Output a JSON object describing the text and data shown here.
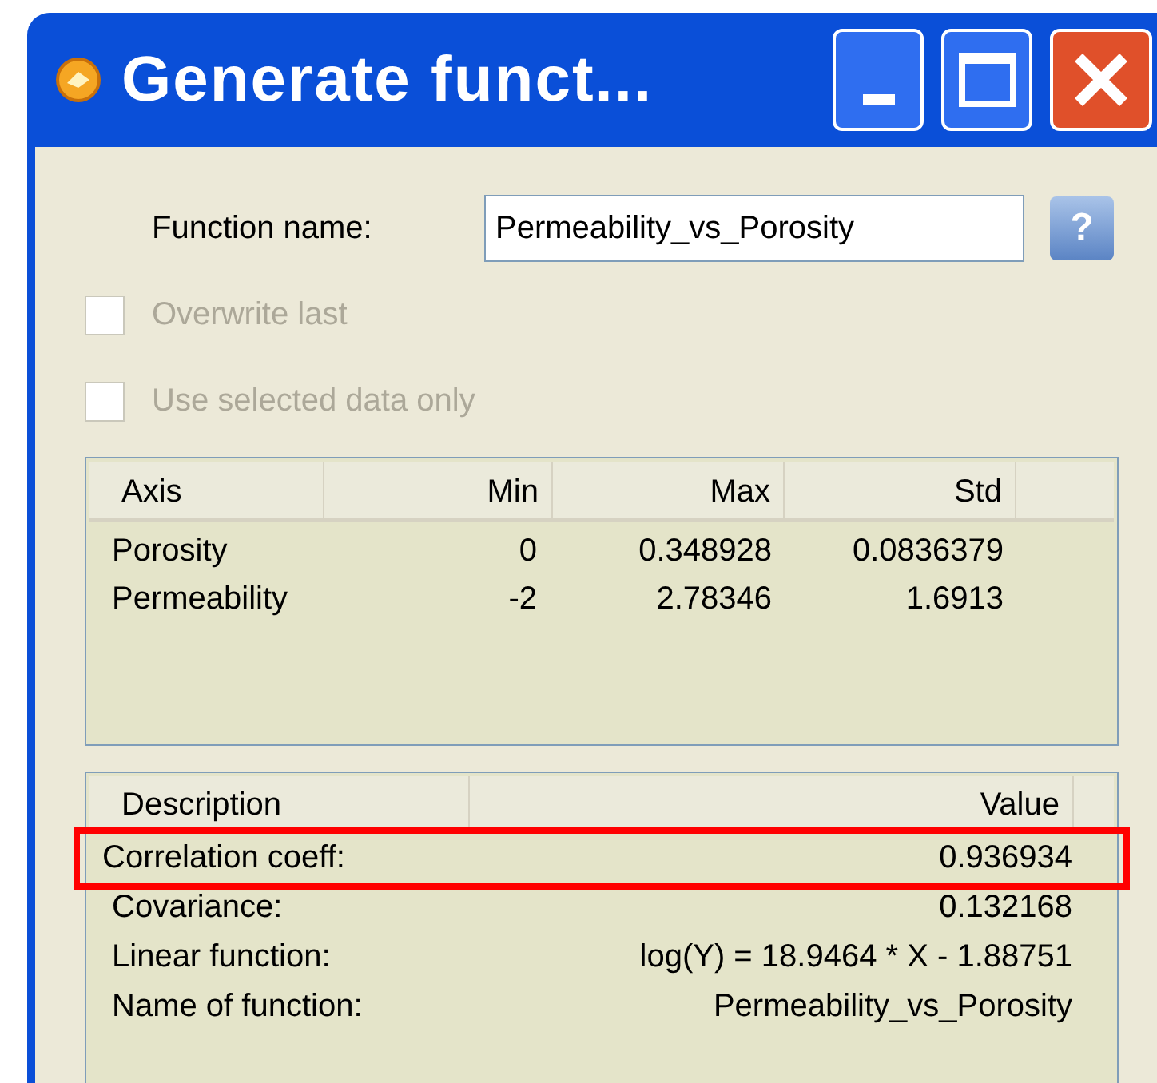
{
  "window": {
    "title": "Generate funct..."
  },
  "function_name": {
    "label": "Function name:",
    "value": "Permeability_vs_Porosity",
    "help": "?"
  },
  "options": [
    {
      "label": "Overwrite last",
      "checked": false,
      "disabled": true
    },
    {
      "label": "Use selected data only",
      "checked": false,
      "disabled": true
    }
  ],
  "axis_table": {
    "columns": [
      "Axis",
      "Min",
      "Max",
      "Std"
    ],
    "rows": [
      [
        "Porosity",
        "0",
        "0.348928",
        "0.0836379"
      ],
      [
        "Permeability",
        "-2",
        "2.78346",
        "1.6913"
      ]
    ]
  },
  "results_table": {
    "columns": [
      "Description",
      "Value"
    ],
    "rows": [
      {
        "description": "Correlation coeff:",
        "value": "0.936934",
        "highlighted": true
      },
      {
        "description": "Covariance:",
        "value": "0.132168",
        "highlighted": false
      },
      {
        "description": "Linear function:",
        "value": "log(Y) = 18.9464 * X - 1.88751",
        "highlighted": false
      },
      {
        "description": "Name of function:",
        "value": "Permeability_vs_Porosity",
        "highlighted": false
      }
    ]
  }
}
